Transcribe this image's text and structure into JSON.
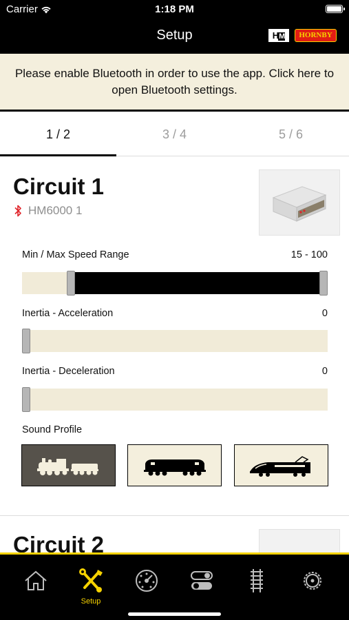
{
  "status_bar": {
    "carrier": "Carrier",
    "time": "1:18 PM"
  },
  "header": {
    "title": "Setup",
    "logo_hm": "H",
    "logo_hm_small": "M",
    "logo_hornby": "HORNBY"
  },
  "banner": {
    "text": "Please enable Bluetooth in order to use the app. Click here to open Bluetooth settings."
  },
  "tabs": [
    {
      "label": "1 / 2",
      "active": true
    },
    {
      "label": "3 / 4",
      "active": false
    },
    {
      "label": "5 / 6",
      "active": false
    }
  ],
  "circuit1": {
    "title": "Circuit 1",
    "device": "HM6000 1",
    "speed_range": {
      "label": "Min / Max Speed Range",
      "value_text": "15 - 100",
      "min": 15,
      "max": 100
    },
    "acceleration": {
      "label": "Inertia - Acceleration",
      "value_text": "0",
      "value": 0
    },
    "deceleration": {
      "label": "Inertia - Deceleration",
      "value_text": "0",
      "value": 0
    },
    "sound_profile": {
      "label": "Sound Profile",
      "options": [
        {
          "icon": "steam-locomotive-icon",
          "selected": true
        },
        {
          "icon": "diesel-locomotive-icon",
          "selected": false
        },
        {
          "icon": "electric-train-icon",
          "selected": false
        }
      ]
    }
  },
  "circuit2": {
    "title": "Circuit 2"
  },
  "tab_bar": {
    "items": [
      {
        "icon": "home-icon",
        "label": ""
      },
      {
        "icon": "wrench-screwdriver-icon",
        "label": "Setup",
        "active": true
      },
      {
        "icon": "speed-dial-icon",
        "label": ""
      },
      {
        "icon": "toggle-switches-icon",
        "label": ""
      },
      {
        "icon": "track-icon",
        "label": ""
      },
      {
        "icon": "gear-icon",
        "label": ""
      }
    ]
  },
  "colors": {
    "accent": "#f6d200",
    "banner_bg": "#f4efdd",
    "track_bg": "#f1ebd8",
    "bluetooth": "#e0242a"
  }
}
